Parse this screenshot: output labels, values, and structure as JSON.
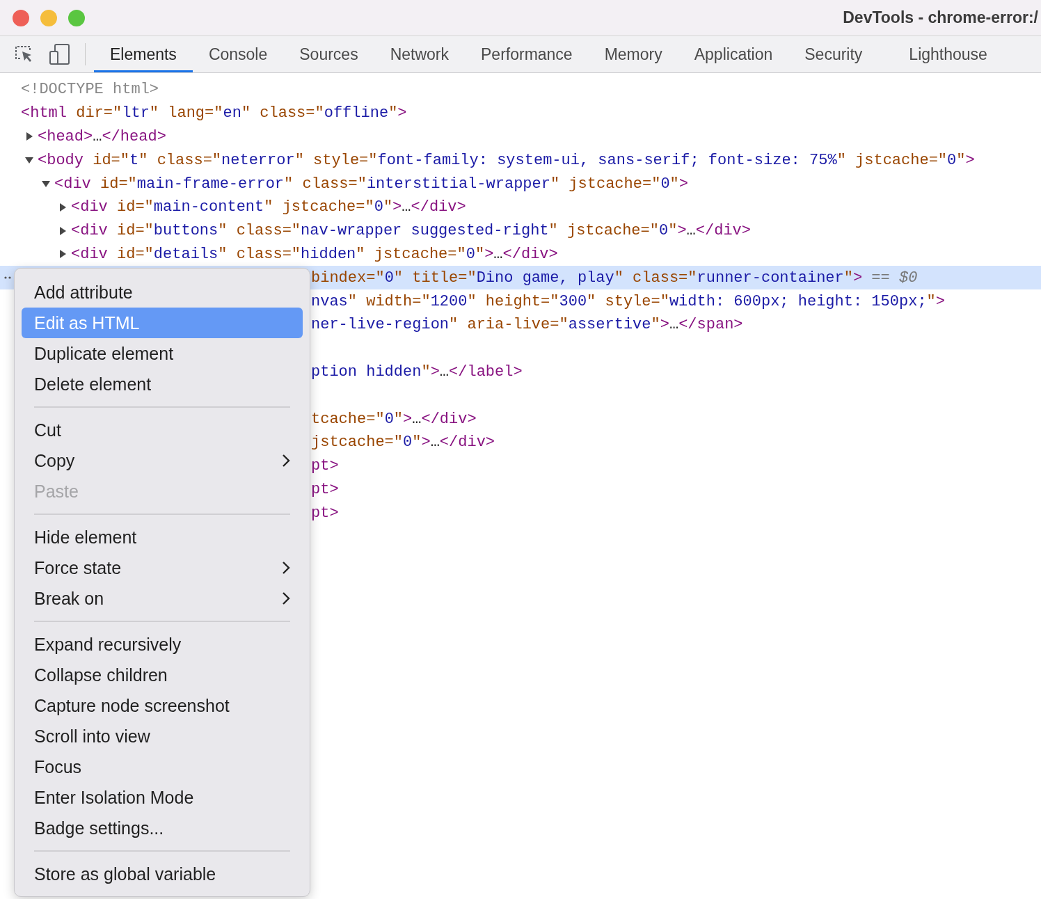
{
  "window": {
    "title": "DevTools - chrome-error:/"
  },
  "toolbar": {
    "tabs": [
      {
        "label": "Elements",
        "selected": true
      },
      {
        "label": "Console",
        "selected": false
      },
      {
        "label": "Sources",
        "selected": false
      },
      {
        "label": "Network",
        "selected": false
      },
      {
        "label": "Performance",
        "selected": false
      },
      {
        "label": "Memory",
        "selected": false
      },
      {
        "label": "Application",
        "selected": false
      },
      {
        "label": "Security",
        "selected": false
      },
      {
        "label": "Lighthouse",
        "selected": false
      }
    ]
  },
  "dom_tree": {
    "lines": [
      {
        "tokens": [
          {
            "kind": "doc",
            "text": "<!DOCTYPE html>"
          }
        ]
      },
      {
        "tokens": [
          {
            "kind": "tag",
            "text": "<html"
          },
          {
            "kind": "attr",
            "text": " dir=\""
          },
          {
            "kind": "val",
            "text": "ltr"
          },
          {
            "kind": "attr",
            "text": "\" lang=\""
          },
          {
            "kind": "val",
            "text": "en"
          },
          {
            "kind": "attr",
            "text": "\" class=\""
          },
          {
            "kind": "val",
            "text": "offline"
          },
          {
            "kind": "attr",
            "text": "\""
          },
          {
            "kind": "tag",
            "text": ">"
          }
        ],
        "children": [
          {
            "expanded": false,
            "tokens": [
              {
                "kind": "tag",
                "text": "<head>"
              },
              {
                "kind": "text",
                "text": "…"
              },
              {
                "kind": "tag",
                "text": "</head>"
              }
            ]
          },
          {
            "expanded": true,
            "tokens": [
              {
                "kind": "tag",
                "text": "<body"
              },
              {
                "kind": "attr",
                "text": " id=\""
              },
              {
                "kind": "val",
                "text": "t"
              },
              {
                "kind": "attr",
                "text": "\" class=\""
              },
              {
                "kind": "val",
                "text": "neterror"
              },
              {
                "kind": "attr",
                "text": "\" style=\""
              },
              {
                "kind": "val",
                "text": "font-family: system-ui, sans-serif; font-size: 75%"
              },
              {
                "kind": "attr",
                "text": "\" jstcache=\""
              },
              {
                "kind": "val",
                "text": "0"
              },
              {
                "kind": "attr",
                "text": "\""
              },
              {
                "kind": "tag",
                "text": ">"
              }
            ],
            "children": [
              {
                "expanded": true,
                "tokens": [
                  {
                    "kind": "tag",
                    "text": "<div"
                  },
                  {
                    "kind": "attr",
                    "text": " id=\""
                  },
                  {
                    "kind": "val",
                    "text": "main-frame-error"
                  },
                  {
                    "kind": "attr",
                    "text": "\" class=\""
                  },
                  {
                    "kind": "val",
                    "text": "interstitial-wrapper"
                  },
                  {
                    "kind": "attr",
                    "text": "\" jstcache=\""
                  },
                  {
                    "kind": "val",
                    "text": "0"
                  },
                  {
                    "kind": "attr",
                    "text": "\""
                  },
                  {
                    "kind": "tag",
                    "text": ">"
                  }
                ],
                "children": [
                  {
                    "expanded": false,
                    "tokens": [
                      {
                        "kind": "tag",
                        "text": "<div"
                      },
                      {
                        "kind": "attr",
                        "text": " id=\""
                      },
                      {
                        "kind": "val",
                        "text": "main-content"
                      },
                      {
                        "kind": "attr",
                        "text": "\" jstcache=\""
                      },
                      {
                        "kind": "val",
                        "text": "0"
                      },
                      {
                        "kind": "attr",
                        "text": "\""
                      },
                      {
                        "kind": "tag",
                        "text": ">"
                      },
                      {
                        "kind": "text",
                        "text": "…"
                      },
                      {
                        "kind": "tag",
                        "text": "</div>"
                      }
                    ]
                  },
                  {
                    "expanded": false,
                    "tokens": [
                      {
                        "kind": "tag",
                        "text": "<div"
                      },
                      {
                        "kind": "attr",
                        "text": " id=\""
                      },
                      {
                        "kind": "val",
                        "text": "buttons"
                      },
                      {
                        "kind": "attr",
                        "text": "\" class=\""
                      },
                      {
                        "kind": "val",
                        "text": "nav-wrapper suggested-right"
                      },
                      {
                        "kind": "attr",
                        "text": "\" jstcache=\""
                      },
                      {
                        "kind": "val",
                        "text": "0"
                      },
                      {
                        "kind": "attr",
                        "text": "\""
                      },
                      {
                        "kind": "tag",
                        "text": ">"
                      },
                      {
                        "kind": "text",
                        "text": "…"
                      },
                      {
                        "kind": "tag",
                        "text": "</div>"
                      }
                    ]
                  },
                  {
                    "expanded": false,
                    "tokens": [
                      {
                        "kind": "tag",
                        "text": "<div"
                      },
                      {
                        "kind": "attr",
                        "text": " id=\""
                      },
                      {
                        "kind": "val",
                        "text": "details"
                      },
                      {
                        "kind": "attr",
                        "text": "\" class=\""
                      },
                      {
                        "kind": "val",
                        "text": "hidden"
                      },
                      {
                        "kind": "attr",
                        "text": "\" jstcache=\""
                      },
                      {
                        "kind": "val",
                        "text": "0"
                      },
                      {
                        "kind": "attr",
                        "text": "\""
                      },
                      {
                        "kind": "tag",
                        "text": ">"
                      },
                      {
                        "kind": "text",
                        "text": "…"
                      },
                      {
                        "kind": "tag",
                        "text": "</div>"
                      }
                    ]
                  }
                ]
              }
            ]
          }
        ]
      }
    ],
    "covered_lines": [
      {
        "selected": true,
        "tokens": [
          {
            "kind": "attr",
            "text": "bindex=\""
          },
          {
            "kind": "val",
            "text": "0"
          },
          {
            "kind": "attr",
            "text": "\" title=\""
          },
          {
            "kind": "val",
            "text": "Dino game, play"
          },
          {
            "kind": "attr",
            "text": "\" class=\""
          },
          {
            "kind": "val",
            "text": "runner-container"
          },
          {
            "kind": "attr",
            "text": "\""
          },
          {
            "kind": "tag",
            "text": ">"
          },
          {
            "kind": "hint",
            "text": " == $0"
          }
        ]
      },
      {
        "selected": false,
        "tokens": [
          {
            "kind": "val",
            "text": "nvas"
          },
          {
            "kind": "attr",
            "text": "\" width=\""
          },
          {
            "kind": "val",
            "text": "1200"
          },
          {
            "kind": "attr",
            "text": "\" height=\""
          },
          {
            "kind": "val",
            "text": "300"
          },
          {
            "kind": "attr",
            "text": "\" style=\""
          },
          {
            "kind": "val",
            "text": "width: 600px; height: 150px;"
          },
          {
            "kind": "attr",
            "text": "\""
          },
          {
            "kind": "tag",
            "text": ">"
          }
        ]
      },
      {
        "selected": false,
        "tokens": [
          {
            "kind": "val",
            "text": "ner-live-region"
          },
          {
            "kind": "attr",
            "text": "\" aria-live=\""
          },
          {
            "kind": "val",
            "text": "assertive"
          },
          {
            "kind": "attr",
            "text": "\""
          },
          {
            "kind": "tag",
            "text": ">"
          },
          {
            "kind": "text",
            "text": "…"
          },
          {
            "kind": "tag",
            "text": "</span>"
          }
        ]
      },
      {
        "selected": false
      },
      {
        "selected": false,
        "tokens": [
          {
            "kind": "val",
            "text": "ption hidden"
          },
          {
            "kind": "attr",
            "text": "\""
          },
          {
            "kind": "tag",
            "text": ">"
          },
          {
            "kind": "text",
            "text": "…"
          },
          {
            "kind": "tag",
            "text": "</label>"
          }
        ]
      },
      {
        "selected": false
      },
      {
        "selected": false,
        "tokens": [
          {
            "kind": "attr",
            "text": "tcache=\""
          },
          {
            "kind": "val",
            "text": "0"
          },
          {
            "kind": "attr",
            "text": "\""
          },
          {
            "kind": "tag",
            "text": ">"
          },
          {
            "kind": "text",
            "text": "…"
          },
          {
            "kind": "tag",
            "text": "</div>"
          }
        ]
      },
      {
        "selected": false,
        "tokens": [
          {
            "kind": "attr",
            "text": "jstcache=\""
          },
          {
            "kind": "val",
            "text": "0"
          },
          {
            "kind": "attr",
            "text": "\""
          },
          {
            "kind": "tag",
            "text": ">"
          },
          {
            "kind": "text",
            "text": "…"
          },
          {
            "kind": "tag",
            "text": "</div>"
          }
        ]
      },
      {
        "selected": false,
        "tokens": [
          {
            "kind": "tag",
            "text": "pt>"
          }
        ]
      },
      {
        "selected": false,
        "tokens": [
          {
            "kind": "tag",
            "text": "pt>"
          }
        ]
      },
      {
        "selected": false,
        "tokens": [
          {
            "kind": "tag",
            "text": "pt>"
          }
        ]
      }
    ]
  },
  "context_menu": {
    "items": [
      {
        "kind": "item",
        "label": "Add attribute",
        "selected": false,
        "disabled": false,
        "submenu": false
      },
      {
        "kind": "item",
        "label": "Edit as HTML",
        "selected": true,
        "disabled": false,
        "submenu": false
      },
      {
        "kind": "item",
        "label": "Duplicate element",
        "selected": false,
        "disabled": false,
        "submenu": false
      },
      {
        "kind": "item",
        "label": "Delete element",
        "selected": false,
        "disabled": false,
        "submenu": false
      },
      {
        "kind": "separator"
      },
      {
        "kind": "item",
        "label": "Cut",
        "selected": false,
        "disabled": false,
        "submenu": false
      },
      {
        "kind": "item",
        "label": "Copy",
        "selected": false,
        "disabled": false,
        "submenu": true
      },
      {
        "kind": "item",
        "label": "Paste",
        "selected": false,
        "disabled": true,
        "submenu": false
      },
      {
        "kind": "separator"
      },
      {
        "kind": "item",
        "label": "Hide element",
        "selected": false,
        "disabled": false,
        "submenu": false
      },
      {
        "kind": "item",
        "label": "Force state",
        "selected": false,
        "disabled": false,
        "submenu": true
      },
      {
        "kind": "item",
        "label": "Break on",
        "selected": false,
        "disabled": false,
        "submenu": true
      },
      {
        "kind": "separator"
      },
      {
        "kind": "item",
        "label": "Expand recursively",
        "selected": false,
        "disabled": false,
        "submenu": false
      },
      {
        "kind": "item",
        "label": "Collapse children",
        "selected": false,
        "disabled": false,
        "submenu": false
      },
      {
        "kind": "item",
        "label": "Capture node screenshot",
        "selected": false,
        "disabled": false,
        "submenu": false
      },
      {
        "kind": "item",
        "label": "Scroll into view",
        "selected": false,
        "disabled": false,
        "submenu": false
      },
      {
        "kind": "item",
        "label": "Focus",
        "selected": false,
        "disabled": false,
        "submenu": false
      },
      {
        "kind": "item",
        "label": "Enter Isolation Mode",
        "selected": false,
        "disabled": false,
        "submenu": false
      },
      {
        "kind": "item",
        "label": "Badge settings...",
        "selected": false,
        "disabled": false,
        "submenu": false
      },
      {
        "kind": "separator"
      },
      {
        "kind": "item",
        "label": "Store as global variable",
        "selected": false,
        "disabled": false,
        "submenu": false
      }
    ]
  }
}
